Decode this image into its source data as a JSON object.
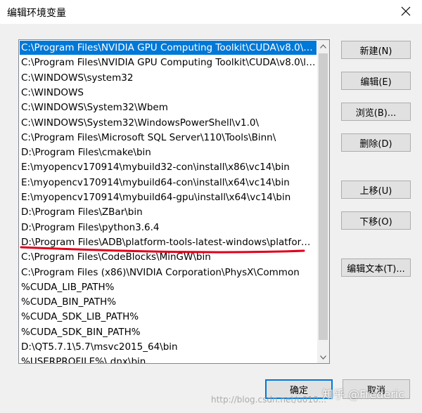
{
  "window": {
    "title": "编辑环境变量"
  },
  "paths": [
    "C:\\Program Files\\NVIDIA GPU Computing Toolkit\\CUDA\\v8.0\\bin",
    "C:\\Program Files\\NVIDIA GPU Computing Toolkit\\CUDA\\v8.0\\li...",
    "C:\\WINDOWS\\system32",
    "C:\\WINDOWS",
    "C:\\WINDOWS\\System32\\Wbem",
    "C:\\WINDOWS\\System32\\WindowsPowerShell\\v1.0\\",
    "C:\\Program Files\\Microsoft SQL Server\\110\\Tools\\Binn\\",
    "D:\\Program Files\\cmake\\bin",
    "E:\\myopencv170914\\mybuild32-con\\install\\x86\\vc14\\bin",
    "E:\\myopencv170914\\mybuild64-con\\install\\x64\\vc14\\bin",
    "E:\\myopencv170914\\mybuild64-gpu\\install\\x64\\vc14\\bin",
    "D:\\Program Files\\ZBar\\bin",
    "D:\\Program Files\\python3.6.4",
    "D:\\Program Files\\ADB\\platform-tools-latest-windows\\platform...",
    "C:\\Program Files\\CodeBlocks\\MinGW\\bin",
    "C:\\Program Files (x86)\\NVIDIA Corporation\\PhysX\\Common",
    "%CUDA_LIB_PATH%",
    "%CUDA_BIN_PATH%",
    "%CUDA_SDK_LIB_PATH%",
    "%CUDA_SDK_BIN_PATH%",
    "D:\\QT5.7.1\\5.7\\msvc2015_64\\bin",
    "%USERPROFILE%\\.dnx\\bin"
  ],
  "selected_index": 0,
  "buttons": {
    "new": "新建(N)",
    "edit": "编辑(E)",
    "browse": "浏览(B)...",
    "delete": "删除(D)",
    "move_up": "上移(U)",
    "move_down": "下移(O)",
    "edit_text": "编辑文本(T)...",
    "ok": "确定",
    "cancel": "取消"
  },
  "watermark": {
    "text": "知乎 @Frederic",
    "url": "http://blog.csdn.net/u010..."
  },
  "colors": {
    "selection": "#0078d7",
    "annotation": "#e0001b"
  }
}
